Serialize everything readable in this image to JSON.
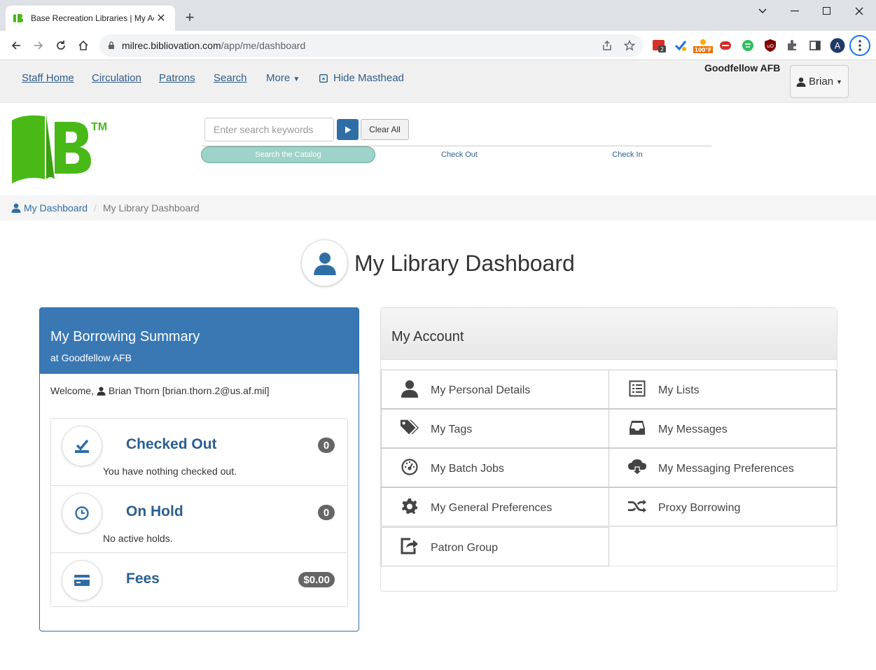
{
  "browser": {
    "tab_title": "Base Recreation Libraries | My Ac",
    "url_host": "milrec.bibliovation.com",
    "url_path": "/app/me/dashboard",
    "ext_badge_count": "2",
    "ext_temp": "100°F"
  },
  "masthead": {
    "nav": [
      "Staff Home",
      "Circulation",
      "Patrons",
      "Search"
    ],
    "more_label": "More",
    "hide_label": "Hide Masthead",
    "location": "Goodfellow AFB",
    "user_label": "Brian"
  },
  "header_search": {
    "placeholder": "Enter search keywords",
    "clear_label": "Clear All",
    "modes": [
      "Search the Catalog",
      "Check Out",
      "Check In"
    ]
  },
  "breadcrumb": {
    "home": "My Dashboard",
    "current": "My Library Dashboard"
  },
  "page": {
    "title": "My Library Dashboard"
  },
  "summary": {
    "title": "My Borrowing Summary",
    "subtitle": "at Goodfellow AFB",
    "welcome_prefix": "Welcome,",
    "welcome_user": "Brian Thorn [brian.thorn.2@us.af.mil]",
    "items": [
      {
        "label": "Checked Out",
        "count": "0",
        "desc": "You have nothing checked out."
      },
      {
        "label": "On Hold",
        "count": "0",
        "desc": "No active holds."
      },
      {
        "label": "Fees",
        "count": "$0.00",
        "desc": ""
      }
    ]
  },
  "account": {
    "title": "My Account",
    "items": [
      {
        "label": "My Personal Details",
        "icon": "user-icon"
      },
      {
        "label": "My Lists",
        "icon": "list-icon"
      },
      {
        "label": "My Tags",
        "icon": "tags-icon"
      },
      {
        "label": "My Messages",
        "icon": "inbox-icon"
      },
      {
        "label": "My Batch Jobs",
        "icon": "dashboard-icon"
      },
      {
        "label": "My Messaging Preferences",
        "icon": "cloud-download-icon"
      },
      {
        "label": "My General Preferences",
        "icon": "cog-icon"
      },
      {
        "label": "Proxy Borrowing",
        "icon": "random-icon"
      },
      {
        "label": "Patron Group",
        "icon": "share-icon"
      }
    ]
  },
  "colors": {
    "brand_green": "#49b917",
    "link_blue": "#2f6ea5",
    "panel_blue": "#3a78b4"
  }
}
